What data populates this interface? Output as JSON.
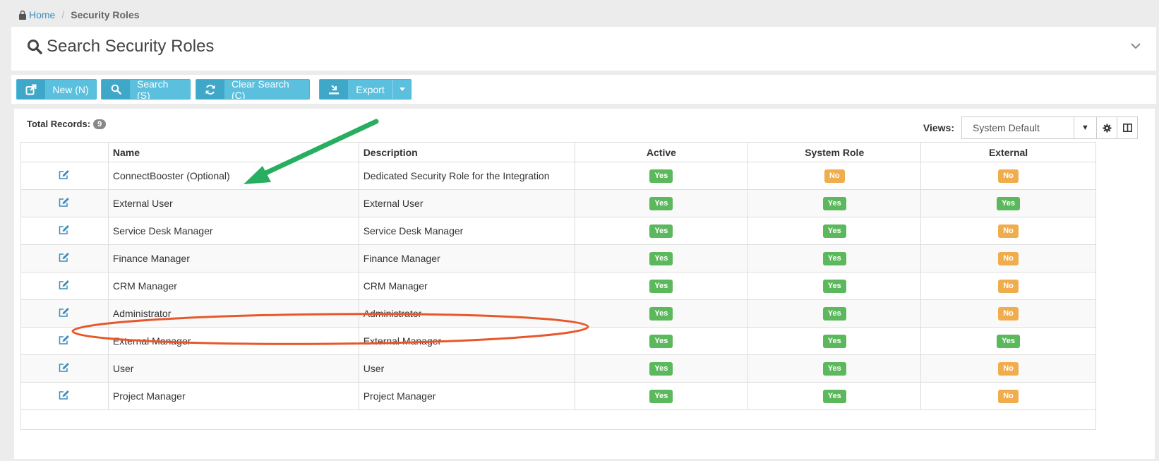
{
  "breadcrumb": {
    "home": "Home",
    "current": "Security Roles"
  },
  "search_panel": {
    "title": "Search Security Roles"
  },
  "toolbar": {
    "new_label": "New (N)",
    "search_label": "Search (S)",
    "clear_label": "Clear Search (C)",
    "export_label": "Export"
  },
  "results": {
    "total_label": "Total Records:",
    "total_count": "9",
    "views_label": "Views:",
    "views_selected": "System Default"
  },
  "table": {
    "columns": [
      "Name",
      "Description",
      "Active",
      "System Role",
      "External"
    ],
    "rows": [
      {
        "name": "ConnectBooster (Optional)",
        "description": "Dedicated Security Role for the Integration",
        "active": "Yes",
        "system_role": "No",
        "external": "No"
      },
      {
        "name": "External User",
        "description": "External User",
        "active": "Yes",
        "system_role": "Yes",
        "external": "Yes"
      },
      {
        "name": "Service Desk Manager",
        "description": "Service Desk Manager",
        "active": "Yes",
        "system_role": "Yes",
        "external": "No"
      },
      {
        "name": "Finance Manager",
        "description": "Finance Manager",
        "active": "Yes",
        "system_role": "Yes",
        "external": "No"
      },
      {
        "name": "CRM Manager",
        "description": "CRM Manager",
        "active": "Yes",
        "system_role": "Yes",
        "external": "No"
      },
      {
        "name": "Administrator",
        "description": "Administrator",
        "active": "Yes",
        "system_role": "Yes",
        "external": "No"
      },
      {
        "name": "External Manager",
        "description": "External Manager",
        "active": "Yes",
        "system_role": "Yes",
        "external": "Yes"
      },
      {
        "name": "User",
        "description": "User",
        "active": "Yes",
        "system_role": "Yes",
        "external": "No"
      },
      {
        "name": "Project Manager",
        "description": "Project Manager",
        "active": "Yes",
        "system_role": "Yes",
        "external": "No"
      }
    ]
  },
  "colors": {
    "yes": "#5cb85c",
    "no": "#f0ad4e",
    "button": "#5bc0de",
    "link": "#3c8dbc",
    "arrow_annotation": "#27ae60",
    "ellipse_annotation": "#e8572a"
  }
}
